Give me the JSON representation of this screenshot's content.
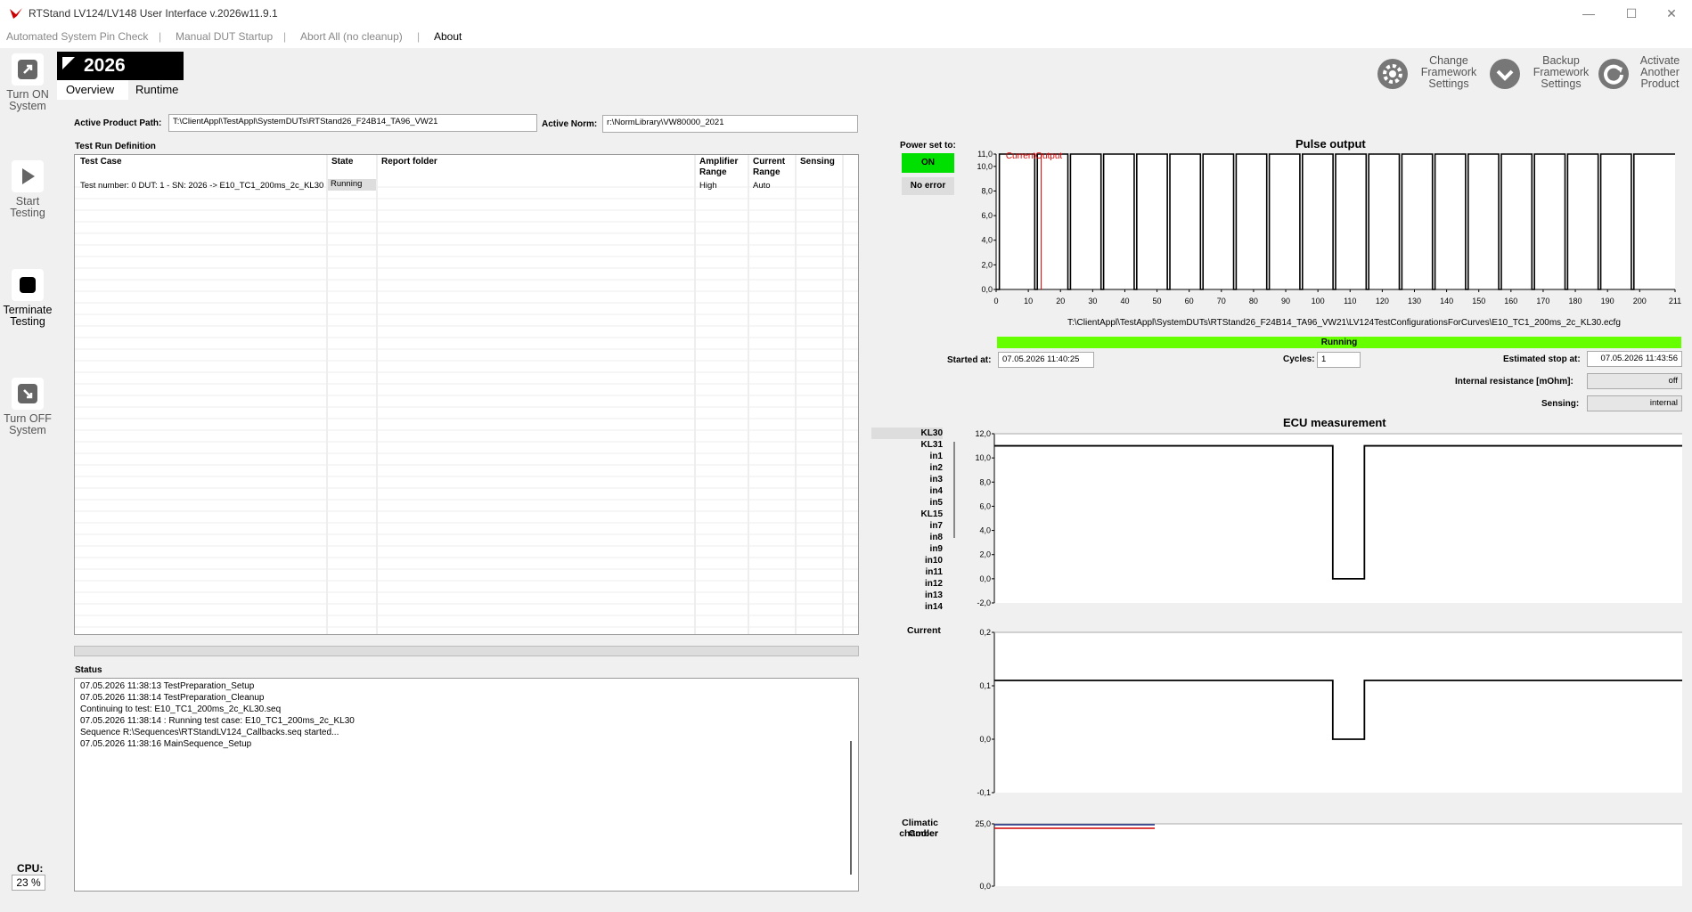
{
  "window": {
    "title": "RTStand LV124/LV148 User Interface v.2026w11.9.1",
    "minimize": "—",
    "maximize": "☐",
    "close": "✕"
  },
  "menu": [
    "Automated System Pin Check",
    "Manual DUT Startup",
    "Abort All (no cleanup)",
    "About"
  ],
  "sidebar": {
    "turn_on": "Turn ON System",
    "start": "Start Testing",
    "terminate": "Terminate Testing",
    "turn_off": "Turn OFF System",
    "cpu_label": "CPU:",
    "cpu_value": "23 %"
  },
  "year": "2026",
  "tabs": [
    "Overview",
    "Runtime"
  ],
  "top_buttons": [
    "Change Framework Settings",
    "Backup Framework Settings",
    "Activate Another Product"
  ],
  "product_path": {
    "label": "Active Product Path:",
    "value": "T:\\ClientAppl\\TestAppl\\SystemDUTs\\RTStand26_F24B14_TA96_VW21"
  },
  "norm": {
    "label": "Active Norm:",
    "value": "r:\\NormLibrary\\VW80000_2021"
  },
  "test_run": {
    "title": "Test Run Definition",
    "columns": [
      "Test Case",
      "State",
      "Report folder",
      "Amplifier Range",
      "Current Range",
      "Sensing"
    ],
    "rows": [
      {
        "test_case": "Test number: 0 DUT: 1 - SN: 2026 -> E10_TC1_200ms_2c_KL30",
        "state": "Running",
        "report": "",
        "amplifier": "High",
        "current": "Auto",
        "sensing": ""
      }
    ]
  },
  "status": {
    "title": "Status",
    "lines": [
      "07.05.2026 11:38:13 TestPreparation_Setup",
      "07.05.2026 11:38:14 TestPreparation_Cleanup",
      "Continuing to test: E10_TC1_200ms_2c_KL30.seq",
      "07.05.2026 11:38:14 : Running test case: E10_TC1_200ms_2c_KL30",
      "Sequence R:\\Sequences\\RTStandLV124_Callbacks.seq started...",
      "07.05.2026 11:38:16 MainSequence_Setup"
    ]
  },
  "power": {
    "label": "Power set to:",
    "on": "ON",
    "error": "No error"
  },
  "pulse": {
    "title": "Pulse output",
    "legend": "CurrentOutput",
    "file": "T:\\ClientAppl\\TestAppl\\SystemDUTs\\RTStand26_F24B14_TA96_VW21\\LV124TestConfigurationsForCurves\\E10_TC1_200ms_2c_KL30.ecfg",
    "yticks": [
      "11,0",
      "10,0",
      "8,0",
      "6,0",
      "4,0",
      "2,0",
      "0,0"
    ],
    "xticks": [
      "0",
      "10",
      "20",
      "30",
      "40",
      "50",
      "60",
      "70",
      "80",
      "90",
      "100",
      "110",
      "120",
      "130",
      "140",
      "150",
      "160",
      "170",
      "180",
      "190",
      "200",
      "211"
    ],
    "cursor_x": 14
  },
  "run": {
    "state": "Running",
    "started_label": "Started at:",
    "started": "07.05.2026 11:40:25",
    "cycles_label": "Cycles:",
    "cycles": "1",
    "stop_label": "Estimated stop at:",
    "stop": "07.05.2026 11:43:56",
    "ir_label": "Internal resistance [mOhm]:",
    "ir": "off",
    "sensing_label": "Sensing:",
    "sensing": "internal"
  },
  "ecu": {
    "title": "ECU measurement",
    "channels": [
      "KL30",
      "KL31",
      "in1",
      "in2",
      "in3",
      "in4",
      "in5",
      "KL15",
      "in7",
      "in8",
      "in9",
      "in10",
      "in11",
      "in12",
      "in13",
      "in14"
    ],
    "yticks": [
      "12,0",
      "10,0",
      "8,0",
      "6,0",
      "4,0",
      "2,0",
      "0,0",
      "-2,0"
    ]
  },
  "current": {
    "label": "Current",
    "yticks": [
      "0,2",
      "0,1",
      "0,0",
      "-0,1"
    ]
  },
  "climatic": {
    "label1": "Climatic chamber",
    "label2": "Cooler",
    "yticks": [
      "25,0",
      "0,0"
    ]
  },
  "colors": {
    "on_green": "#00e000",
    "running_green": "#66ff00",
    "cursor_red": "#e00000"
  }
}
